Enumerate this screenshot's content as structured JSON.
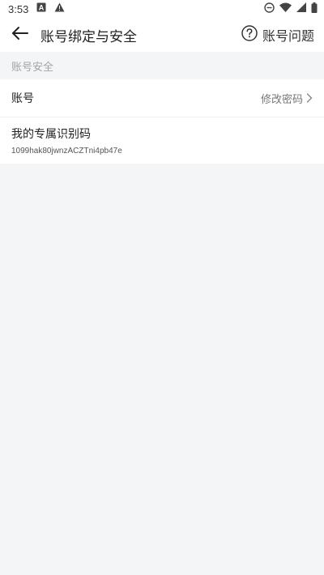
{
  "status_bar": {
    "time": "3:53",
    "icons": [
      "a-notification-icon",
      "warning-icon",
      "do-not-disturb-icon",
      "wifi-icon",
      "signal-icon",
      "battery-icon"
    ]
  },
  "header": {
    "title": "账号绑定与安全",
    "help_label": "账号问题",
    "icons": {
      "back": "back-arrow-icon",
      "help": "question-circle-icon"
    }
  },
  "section": {
    "title": "账号安全"
  },
  "account_row": {
    "label": "账号",
    "action_label": "修改密码",
    "action_icon": "chevron-right-icon"
  },
  "id_row": {
    "label": "我的专属识别码",
    "value": "1099hak80jwnzACZTni4pb47e"
  },
  "colors": {
    "background": "#f4f5f7",
    "card": "#ffffff",
    "muted_text": "#a0a3a8"
  }
}
